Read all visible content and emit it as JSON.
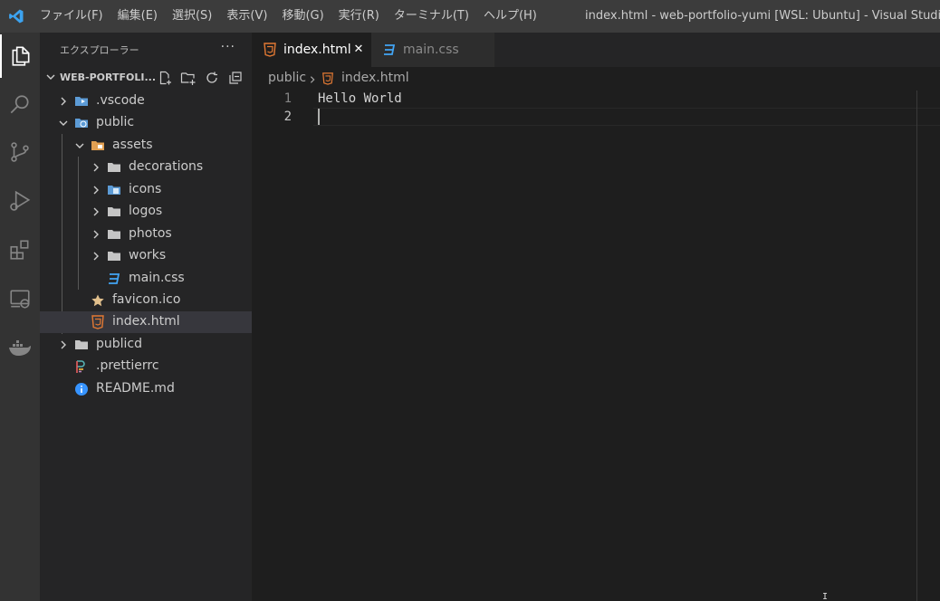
{
  "menu": [
    "ファイル(F)",
    "編集(E)",
    "選択(S)",
    "表示(V)",
    "移動(G)",
    "実行(R)",
    "ターミナル(T)",
    "ヘルプ(H)"
  ],
  "window_title": "index.html - web-portfolio-yumi [WSL: Ubuntu] - Visual Studio Code",
  "activity_bar": [
    "explorer-icon",
    "search-icon",
    "source-control-icon",
    "run-debug-icon",
    "extensions-icon",
    "remote-explorer-icon",
    "docker-icon"
  ],
  "sidebar": {
    "title": "エクスプローラー",
    "more": "···",
    "section_title": "WEB-PORTFOLI...",
    "tree": [
      {
        "label": ".vscode",
        "depth": 0,
        "type": "folder",
        "expanded": false,
        "icon": "vscode-folder-icon"
      },
      {
        "label": "public",
        "depth": 0,
        "type": "folder",
        "expanded": true,
        "icon": "public-folder-icon"
      },
      {
        "label": "assets",
        "depth": 1,
        "type": "folder",
        "expanded": true,
        "icon": "assets-folder-icon"
      },
      {
        "label": "decorations",
        "depth": 2,
        "type": "folder",
        "expanded": false,
        "icon": "folder-icon"
      },
      {
        "label": "icons",
        "depth": 2,
        "type": "folder",
        "expanded": false,
        "icon": "icons-folder-icon"
      },
      {
        "label": "logos",
        "depth": 2,
        "type": "folder",
        "expanded": false,
        "icon": "folder-icon"
      },
      {
        "label": "photos",
        "depth": 2,
        "type": "folder",
        "expanded": false,
        "icon": "folder-icon"
      },
      {
        "label": "works",
        "depth": 2,
        "type": "folder",
        "expanded": false,
        "icon": "folder-icon"
      },
      {
        "label": "main.css",
        "depth": 2,
        "type": "file",
        "icon": "css-file-icon"
      },
      {
        "label": "favicon.ico",
        "depth": 1,
        "type": "file",
        "icon": "favicon-star-icon"
      },
      {
        "label": "index.html",
        "depth": 1,
        "type": "file",
        "icon": "html-file-icon",
        "selected": true
      },
      {
        "label": "publicd",
        "depth": 0,
        "type": "folder",
        "expanded": false,
        "icon": "folder-icon"
      },
      {
        "label": ".prettierrc",
        "depth": 0,
        "type": "file",
        "icon": "prettier-file-icon"
      },
      {
        "label": "README.md",
        "depth": 0,
        "type": "file",
        "icon": "info-file-icon"
      }
    ]
  },
  "tabs": [
    {
      "label": "index.html",
      "active": true,
      "close": "✕"
    },
    {
      "label": "main.css",
      "active": false
    }
  ],
  "breadcrumb": [
    "public",
    "index.html"
  ],
  "editor": {
    "lines": [
      "Hello World",
      ""
    ],
    "line_numbers": [
      "1",
      "2"
    ]
  },
  "colors": {
    "html": "#e37933",
    "css": "#42a5f5",
    "folder": "#c5c5c5",
    "star": "#e2c08d",
    "info": "#3794ff"
  }
}
